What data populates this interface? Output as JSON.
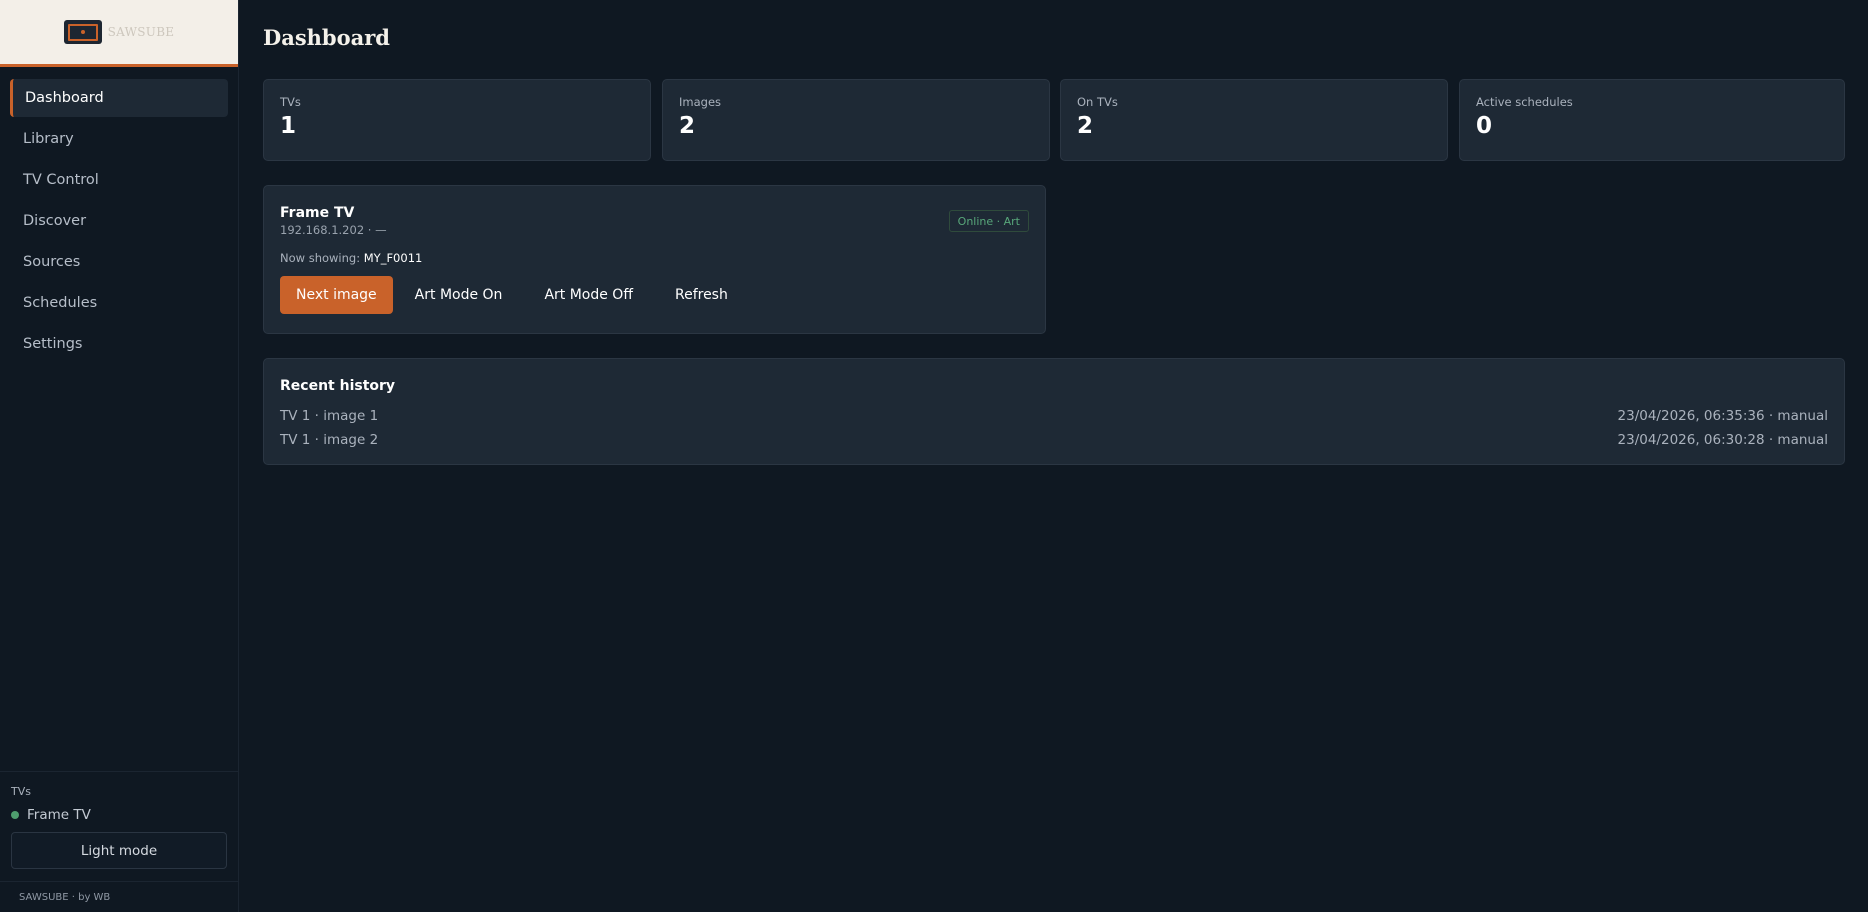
{
  "brand": {
    "name": "SAWSUBE",
    "accent": "#c9622a"
  },
  "sidebar": {
    "items": [
      {
        "label": "Dashboard",
        "active": true
      },
      {
        "label": "Library"
      },
      {
        "label": "TV Control"
      },
      {
        "label": "Discover"
      },
      {
        "label": "Sources"
      },
      {
        "label": "Schedules"
      },
      {
        "label": "Settings"
      }
    ],
    "tvs_title": "TVs",
    "tvs": [
      {
        "name": "Frame TV",
        "status_color": "#4e9d6e"
      }
    ],
    "light_mode_label": "Light mode",
    "footer": "SAWSUBE · by WB"
  },
  "page": {
    "title": "Dashboard"
  },
  "stats": [
    {
      "label": "TVs",
      "value": "1"
    },
    {
      "label": "Images",
      "value": "2"
    },
    {
      "label": "On TVs",
      "value": "2"
    },
    {
      "label": "Active schedules",
      "value": "0"
    }
  ],
  "tv_card": {
    "name": "Frame TV",
    "ip": "192.168.1.202 · —",
    "badge": "Online · Art",
    "now_showing_label": "Now showing:",
    "now_showing_value": "MY_F0011",
    "actions": {
      "next": "Next image",
      "art_on": "Art Mode On",
      "art_off": "Art Mode Off",
      "refresh": "Refresh"
    }
  },
  "history": {
    "title": "Recent history",
    "rows": [
      {
        "left": "TV 1 · image 1",
        "right": "23/04/2026, 06:35:36 · manual"
      },
      {
        "left": "TV 1 · image 2",
        "right": "23/04/2026, 06:30:28 · manual"
      }
    ]
  }
}
